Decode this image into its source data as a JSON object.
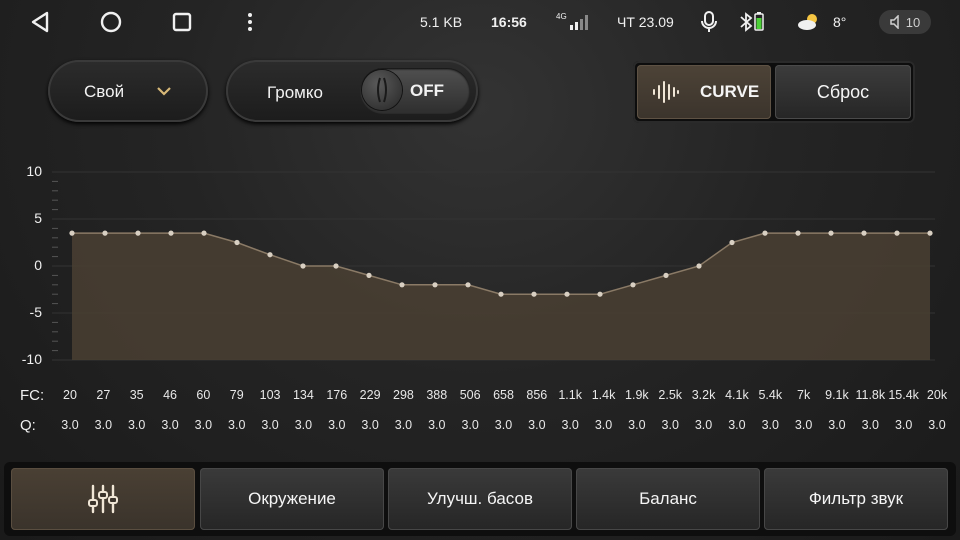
{
  "status_bar": {
    "nav": {
      "back": "back-icon",
      "home": "home-icon",
      "recents": "recents-icon",
      "menu": "menu-dots-icon"
    },
    "speed": "5.1 KB",
    "time": "16:56",
    "signal_label": "4G",
    "date": "ЧТ 23.09",
    "temperature": "8°",
    "volume": "10"
  },
  "controls": {
    "preset_label": "Свой",
    "loudness_label": "Громко",
    "loudness_state": "OFF",
    "curve_label": "CURVE",
    "reset_label": "Сброс"
  },
  "chart_data": {
    "type": "area",
    "y_ticks": [
      "10",
      "5",
      "0",
      "-5",
      "-10"
    ],
    "ylim": [
      -10,
      10
    ],
    "values": [
      3.5,
      3.5,
      3.5,
      3.5,
      3.5,
      2.5,
      1.2,
      0,
      0,
      -1,
      -2,
      -2,
      -2,
      -3,
      -3,
      -3,
      -3,
      -2,
      -1,
      0,
      2.5,
      3.5,
      3.5,
      3.5,
      3.5,
      3.5,
      3.5
    ],
    "fill_color": "#4a3f33",
    "line_color": "#8a7a66"
  },
  "bands": {
    "fc_label": "FC:",
    "q_label": "Q:",
    "fc": [
      "20",
      "27",
      "35",
      "46",
      "60",
      "79",
      "103",
      "134",
      "176",
      "229",
      "298",
      "388",
      "506",
      "658",
      "856",
      "1.1k",
      "1.4k",
      "1.9k",
      "2.5k",
      "3.2k",
      "4.1k",
      "5.4k",
      "7k",
      "9.1k",
      "11.8k",
      "15.4k",
      "20k"
    ],
    "q": [
      "3.0",
      "3.0",
      "3.0",
      "3.0",
      "3.0",
      "3.0",
      "3.0",
      "3.0",
      "3.0",
      "3.0",
      "3.0",
      "3.0",
      "3.0",
      "3.0",
      "3.0",
      "3.0",
      "3.0",
      "3.0",
      "3.0",
      "3.0",
      "3.0",
      "3.0",
      "3.0",
      "3.0",
      "3.0",
      "3.0",
      "3.0"
    ]
  },
  "tabs": {
    "eq_icon": "equalizer-sliders-icon",
    "surround": "Окружение",
    "bass": "Улучш. басов",
    "balance": "Баланс",
    "filter": "Фильтр звук"
  }
}
